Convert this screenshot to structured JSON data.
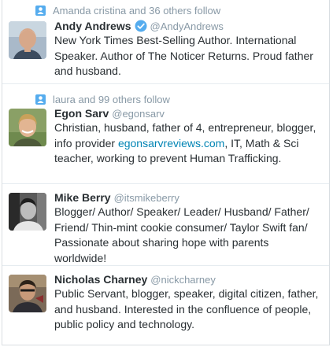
{
  "cards": [
    {
      "social_context": "Amanda cristina and 36 others follow",
      "name": "Andy Andrews",
      "handle": "@AndyAndrews",
      "bio": "New York Times Best-Selling Author. International Speaker. Author of The Noticer Returns. Proud father and husband."
    },
    {
      "social_context": "laura and 99 others follow",
      "name": "Egon Sarv",
      "handle": "@egonsarv",
      "bio_before": "Christian, husband, father of 4, entrepreneur, blogger, info provider ",
      "bio_link": "egonsarvreviews.com",
      "bio_after": ", IT, Math & Sci teacher, working to prevent Human Trafficking."
    },
    {
      "name": "Mike Berry",
      "handle": "@itsmikeberry",
      "bio": "Blogger/ Author/ Speaker/ Leader/ Husband/ Father/ Friend/ Thin-mint cookie consumer/ Taylor Swift fan/ Passionate about sharing hope with parents worldwide!"
    },
    {
      "name": "Nicholas Charney",
      "handle": "@nickcharney",
      "bio": "Public Servant, blogger, speaker, digital citizen, father, and husband. Interested in the confluence of people, public policy and technology."
    }
  ],
  "colors": {
    "link": "#0084b4",
    "muted": "#8899a6",
    "verified": "#55acee"
  },
  "icons": [
    "person-icon",
    "verified-badge-icon"
  ]
}
